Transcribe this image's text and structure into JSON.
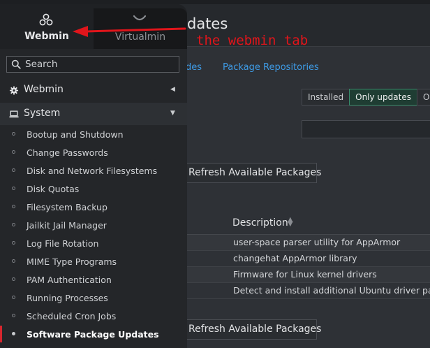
{
  "page": {
    "title_fragment": "dates",
    "tabs": [
      {
        "label": "des"
      },
      {
        "label": "Package Repositories"
      }
    ],
    "filters": [
      {
        "label": "Installed",
        "active": false
      },
      {
        "label": "Only updates",
        "active": true
      },
      {
        "label": "Only",
        "active": false
      }
    ],
    "refresh_label": "Refresh Available Packages",
    "table": {
      "description_header": "Description",
      "rows": [
        {
          "description": "user-space parser utility for AppArmor"
        },
        {
          "description": "changehat AppArmor library"
        },
        {
          "description": "Firmware for Linux kernel drivers"
        },
        {
          "description": "Detect and install additional Ubuntu driver packages"
        }
      ]
    }
  },
  "annotation": {
    "text": "the webmin tab",
    "color": "#e0151b"
  },
  "sidebar": {
    "tabs": {
      "webmin": "Webmin",
      "virtualmin": "Virtualmin"
    },
    "search": {
      "placeholder": "Search"
    },
    "sections": {
      "webmin": "Webmin",
      "system": "System"
    },
    "menu_items": [
      {
        "label": "Bootup and Shutdown"
      },
      {
        "label": "Change Passwords"
      },
      {
        "label": "Disk and Network Filesystems"
      },
      {
        "label": "Disk Quotas"
      },
      {
        "label": "Filesystem Backup"
      },
      {
        "label": "Jailkit Jail Manager"
      },
      {
        "label": "Log File Rotation"
      },
      {
        "label": "MIME Type Programs"
      },
      {
        "label": "PAM Authentication"
      },
      {
        "label": "Running Processes"
      },
      {
        "label": "Scheduled Cron Jobs"
      },
      {
        "label": "Software Package Updates",
        "active": true
      }
    ]
  },
  "colors": {
    "accent_link": "#3e9be6",
    "active_filter_border": "#3a8c6c",
    "active_indicator": "#d7262e"
  }
}
